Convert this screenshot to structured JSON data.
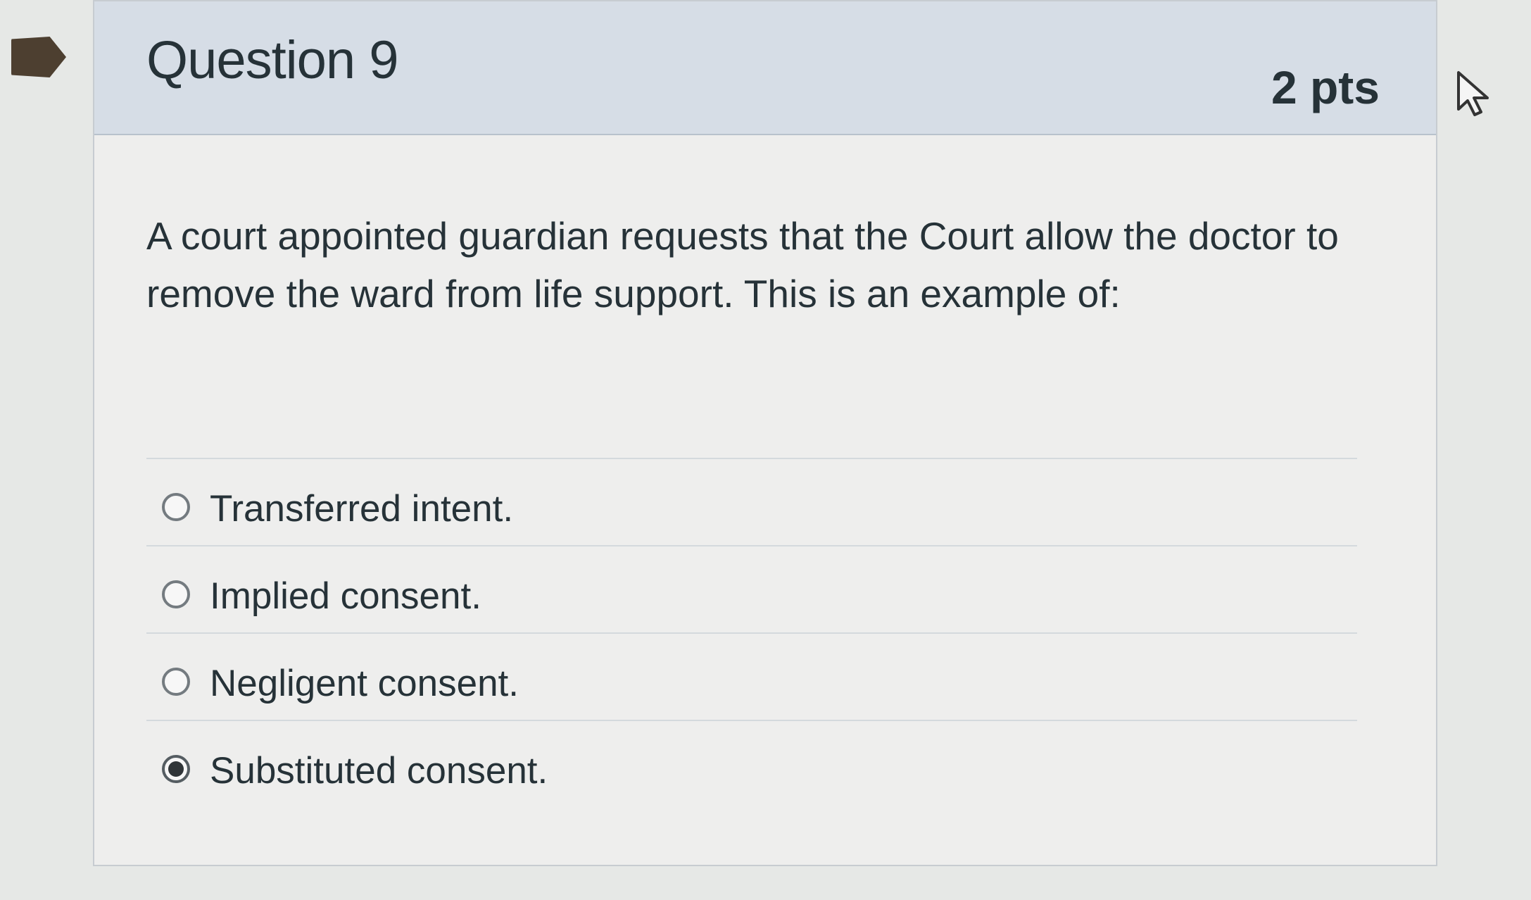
{
  "question": {
    "title": "Question 9",
    "points": "2 pts",
    "text": "A court appointed guardian requests that the Court allow the doctor to remove the ward from life support. This is an example of:"
  },
  "answers": [
    {
      "label": "Transferred intent.",
      "selected": false
    },
    {
      "label": "Implied consent.",
      "selected": false
    },
    {
      "label": "Negligent consent.",
      "selected": false
    },
    {
      "label": "Substituted consent.",
      "selected": true
    }
  ],
  "icons": {
    "flag": "bookmark-flag-icon",
    "cursor": "mouse-pointer-icon"
  },
  "colors": {
    "header_background": "#d6dde6",
    "flag": "#4d3f30",
    "selected_radio": "#303538"
  }
}
